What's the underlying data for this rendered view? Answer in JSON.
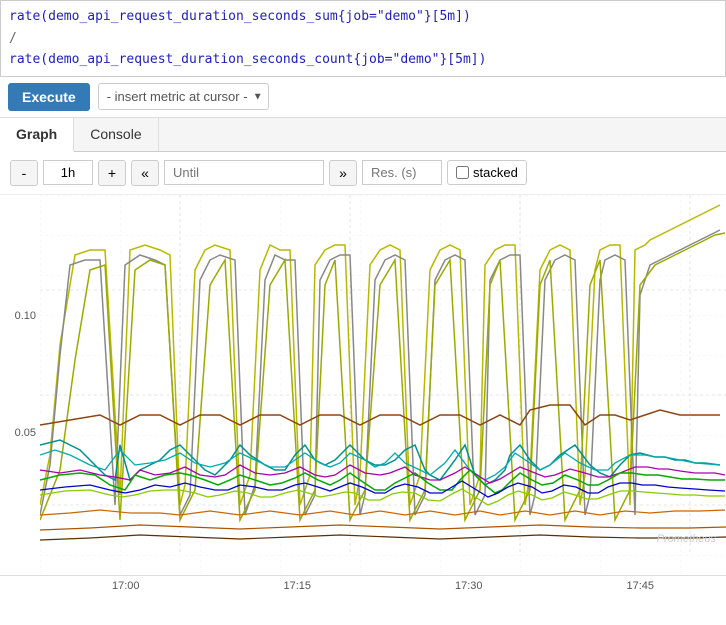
{
  "query": {
    "line1": "rate(demo_api_request_duration_seconds_sum{job=\"demo\"}[5m])",
    "divider": "/",
    "line2": "rate(demo_api_request_duration_seconds_count{job=\"demo\"}[5m])"
  },
  "toolbar": {
    "execute_label": "Execute",
    "metric_placeholder": "- insert metric at cursor -"
  },
  "tabs": [
    {
      "label": "Graph",
      "active": true
    },
    {
      "label": "Console",
      "active": false
    }
  ],
  "graph_controls": {
    "minus_label": "-",
    "time_range": "1h",
    "plus_label": "+",
    "back_label": "«",
    "until_placeholder": "Until",
    "forward_label": "»",
    "res_placeholder": "Res. (s)",
    "stacked_label": "stacked"
  },
  "x_axis": {
    "labels": [
      "17:00",
      "17:15",
      "17:30",
      "17:45"
    ]
  },
  "y_axis": {
    "labels": [
      "0.10",
      "0.05"
    ]
  },
  "watermark": "Prometheus"
}
